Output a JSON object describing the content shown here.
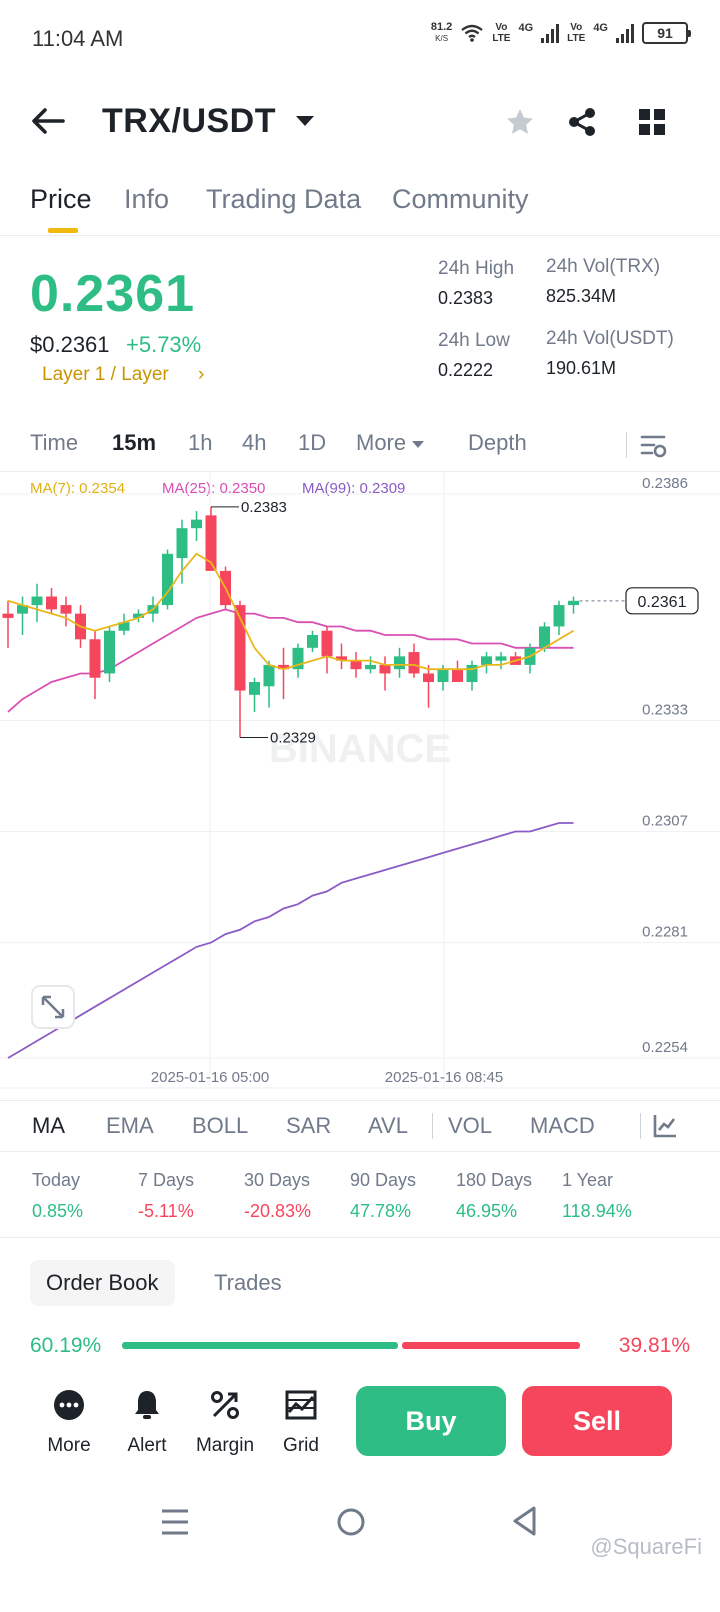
{
  "status_bar": {
    "time": "11:04 AM",
    "net_speed": "81.2",
    "net_speed_unit": "K/S",
    "volte1": "Vo\nLTE",
    "net1": "4G",
    "volte2": "Vo\nLTE",
    "net2": "4G",
    "battery": "91"
  },
  "header": {
    "pair": "TRX/USDT",
    "icons": [
      "back-arrow-icon",
      "star-icon",
      "share-icon",
      "grid-icon"
    ]
  },
  "tabs": [
    {
      "label": "Price",
      "active": true
    },
    {
      "label": "Info",
      "active": false
    },
    {
      "label": "Trading Data",
      "active": false
    },
    {
      "label": "Community",
      "active": false
    }
  ],
  "price": {
    "last": "0.2361",
    "usd": "$0.2361",
    "change": "+5.73%",
    "tags": "Layer 1 / Layer",
    "tags_arrow": "›"
  },
  "stats": {
    "high_label": "24h High",
    "high_value": "0.2383",
    "low_label": "24h Low",
    "low_value": "0.2222",
    "vol_trx_label": "24h Vol(TRX)",
    "vol_trx_value": "825.34M",
    "vol_usdt_label": "24h Vol(USDT)",
    "vol_usdt_value": "190.61M"
  },
  "intervals": {
    "time": "Time",
    "m15": "15m",
    "h1": "1h",
    "h4": "4h",
    "d1": "1D",
    "more": "More",
    "depth": "Depth"
  },
  "ma_legend": {
    "ma7": "MA(7): 0.2354",
    "ma25": "MA(25): 0.2350",
    "ma99": "MA(99): 0.2309"
  },
  "chart_data": {
    "type": "candlestick",
    "x_labels": [
      "2025-01-16 05:00",
      "2025-01-16 08:45"
    ],
    "y_ticks": [
      "0.2386",
      "0.2333",
      "0.2307",
      "0.2281",
      "0.2254"
    ],
    "y_range": [
      0.2254,
      0.2386
    ],
    "high_marker": "0.2383",
    "low_marker": "0.2329",
    "last_price_label": "0.2361",
    "watermark": "BINANCE",
    "colors": {
      "up": "#2ebd85",
      "down": "#f6465d",
      "ma7": "#e8b81b",
      "ma25": "#d94fb4",
      "ma99": "#8a5cc4"
    },
    "candles": [
      {
        "o": 0.2358,
        "h": 0.2361,
        "l": 0.235,
        "c": 0.2357
      },
      {
        "o": 0.2358,
        "h": 0.2362,
        "l": 0.2353,
        "c": 0.236
      },
      {
        "o": 0.236,
        "h": 0.2365,
        "l": 0.2356,
        "c": 0.2362
      },
      {
        "o": 0.2362,
        "h": 0.2364,
        "l": 0.2358,
        "c": 0.2359
      },
      {
        "o": 0.236,
        "h": 0.2362,
        "l": 0.2355,
        "c": 0.2358
      },
      {
        "o": 0.2358,
        "h": 0.236,
        "l": 0.235,
        "c": 0.2352
      },
      {
        "o": 0.2352,
        "h": 0.2354,
        "l": 0.2338,
        "c": 0.2343
      },
      {
        "o": 0.2344,
        "h": 0.2355,
        "l": 0.2342,
        "c": 0.2354
      },
      {
        "o": 0.2354,
        "h": 0.2358,
        "l": 0.2353,
        "c": 0.2356
      },
      {
        "o": 0.2357,
        "h": 0.2359,
        "l": 0.2356,
        "c": 0.2358
      },
      {
        "o": 0.2358,
        "h": 0.2362,
        "l": 0.2356,
        "c": 0.236
      },
      {
        "o": 0.236,
        "h": 0.2373,
        "l": 0.2359,
        "c": 0.2372
      },
      {
        "o": 0.2371,
        "h": 0.238,
        "l": 0.2365,
        "c": 0.2378
      },
      {
        "o": 0.2378,
        "h": 0.2382,
        "l": 0.2375,
        "c": 0.238
      },
      {
        "o": 0.2381,
        "h": 0.2383,
        "l": 0.237,
        "c": 0.2368
      },
      {
        "o": 0.2368,
        "h": 0.2369,
        "l": 0.2359,
        "c": 0.236
      },
      {
        "o": 0.236,
        "h": 0.2361,
        "l": 0.2329,
        "c": 0.234
      },
      {
        "o": 0.2339,
        "h": 0.2343,
        "l": 0.2335,
        "c": 0.2342
      },
      {
        "o": 0.2341,
        "h": 0.2347,
        "l": 0.2336,
        "c": 0.2346
      },
      {
        "o": 0.2346,
        "h": 0.235,
        "l": 0.2338,
        "c": 0.2345
      },
      {
        "o": 0.2345,
        "h": 0.2351,
        "l": 0.2343,
        "c": 0.235
      },
      {
        "o": 0.235,
        "h": 0.2354,
        "l": 0.2349,
        "c": 0.2353
      },
      {
        "o": 0.2354,
        "h": 0.2355,
        "l": 0.2344,
        "c": 0.2348
      },
      {
        "o": 0.2348,
        "h": 0.2351,
        "l": 0.2345,
        "c": 0.2347
      },
      {
        "o": 0.2347,
        "h": 0.2349,
        "l": 0.2343,
        "c": 0.2345
      },
      {
        "o": 0.2345,
        "h": 0.2348,
        "l": 0.2344,
        "c": 0.2346
      },
      {
        "o": 0.2346,
        "h": 0.2348,
        "l": 0.234,
        "c": 0.2344
      },
      {
        "o": 0.2345,
        "h": 0.235,
        "l": 0.2343,
        "c": 0.2348
      },
      {
        "o": 0.2349,
        "h": 0.2351,
        "l": 0.2343,
        "c": 0.2344
      },
      {
        "o": 0.2344,
        "h": 0.2346,
        "l": 0.2336,
        "c": 0.2342
      },
      {
        "o": 0.2342,
        "h": 0.2346,
        "l": 0.234,
        "c": 0.2345
      },
      {
        "o": 0.2345,
        "h": 0.2347,
        "l": 0.2342,
        "c": 0.2342
      },
      {
        "o": 0.2342,
        "h": 0.2347,
        "l": 0.234,
        "c": 0.2346
      },
      {
        "o": 0.2346,
        "h": 0.2349,
        "l": 0.2344,
        "c": 0.2348
      },
      {
        "o": 0.2347,
        "h": 0.2349,
        "l": 0.2345,
        "c": 0.2348
      },
      {
        "o": 0.2348,
        "h": 0.2349,
        "l": 0.2346,
        "c": 0.2346
      },
      {
        "o": 0.2346,
        "h": 0.2351,
        "l": 0.2344,
        "c": 0.235
      },
      {
        "o": 0.235,
        "h": 0.2356,
        "l": 0.2349,
        "c": 0.2355
      },
      {
        "o": 0.2355,
        "h": 0.2361,
        "l": 0.2353,
        "c": 0.236
      },
      {
        "o": 0.236,
        "h": 0.2362,
        "l": 0.2358,
        "c": 0.2361
      }
    ],
    "ma7": [
      0.2361,
      0.236,
      0.2359,
      0.2358,
      0.2357,
      0.2355,
      0.2354,
      0.2355,
      0.2356,
      0.2357,
      0.2359,
      0.2363,
      0.2368,
      0.2372,
      0.237,
      0.2364,
      0.2357,
      0.235,
      0.2346,
      0.2345,
      0.2346,
      0.2347,
      0.2348,
      0.2347,
      0.2347,
      0.2347,
      0.2346,
      0.2346,
      0.2346,
      0.2345,
      0.2345,
      0.2345,
      0.2345,
      0.2346,
      0.2346,
      0.2347,
      0.2348,
      0.235,
      0.2352,
      0.2354
    ],
    "ma25": [
      0.2335,
      0.2338,
      0.234,
      0.2342,
      0.2343,
      0.2344,
      0.2344,
      0.2345,
      0.2347,
      0.2349,
      0.2351,
      0.2353,
      0.2355,
      0.2357,
      0.2358,
      0.2359,
      0.2358,
      0.2358,
      0.2357,
      0.2357,
      0.2356,
      0.2356,
      0.2355,
      0.2355,
      0.2354,
      0.2354,
      0.2353,
      0.2353,
      0.2353,
      0.2352,
      0.2352,
      0.2352,
      0.2351,
      0.2351,
      0.2351,
      0.235,
      0.235,
      0.235,
      0.235,
      0.235
    ],
    "ma99": [
      0.2254,
      0.2256,
      0.2258,
      0.226,
      0.2262,
      0.2264,
      0.2266,
      0.2268,
      0.227,
      0.2272,
      0.2274,
      0.2276,
      0.2278,
      0.228,
      0.2281,
      0.2283,
      0.2284,
      0.2286,
      0.2287,
      0.2289,
      0.229,
      0.2292,
      0.2293,
      0.2295,
      0.2296,
      0.2297,
      0.2298,
      0.2299,
      0.23,
      0.2301,
      0.2302,
      0.2303,
      0.2304,
      0.2305,
      0.2306,
      0.2307,
      0.2307,
      0.2308,
      0.2309,
      0.2309
    ]
  },
  "indicators": {
    "ma": "MA",
    "ema": "EMA",
    "boll": "BOLL",
    "sar": "SAR",
    "avl": "AVL",
    "vol": "VOL",
    "macd": "MACD"
  },
  "performance": [
    {
      "label": "Today",
      "value": "0.85%",
      "color": "#2ebd85"
    },
    {
      "label": "7 Days",
      "value": "-5.11%",
      "color": "#f6465d"
    },
    {
      "label": "30 Days",
      "value": "-20.83%",
      "color": "#f6465d"
    },
    {
      "label": "90 Days",
      "value": "47.78%",
      "color": "#2ebd85"
    },
    {
      "label": "180 Days",
      "value": "46.95%",
      "color": "#2ebd85"
    },
    {
      "label": "1 Year",
      "value": "118.94%",
      "color": "#2ebd85"
    }
  ],
  "orderbook": {
    "tab_orderbook": "Order Book",
    "tab_trades": "Trades",
    "buy_ratio": "60.19%",
    "sell_ratio": "39.81%",
    "buy_fraction": 0.6019
  },
  "actions": {
    "more": "More",
    "alert": "Alert",
    "margin": "Margin",
    "grid": "Grid",
    "buy": "Buy",
    "sell": "Sell"
  },
  "watermark": "@SquareFi"
}
